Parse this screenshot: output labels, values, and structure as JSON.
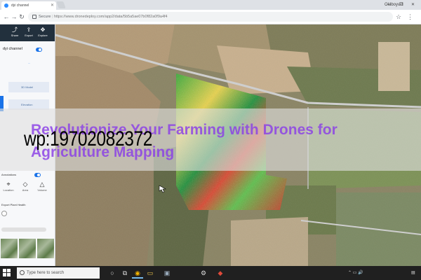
{
  "browser": {
    "tab_title": "dyi channel",
    "window_user": "Oldboyvid",
    "window_controls": "— ❐ ✕",
    "address_prefix": "Secure",
    "url": "https://www.dronedeploy.com/app2/data/5b5a5ae07b0f82a0f9a4f4",
    "nav_back": "←",
    "nav_forward": "→",
    "nav_reload": "↻",
    "star_icon": "☆",
    "menu_icon": "⋮"
  },
  "sidebar": {
    "tools": [
      {
        "icon": "share-icon",
        "glyph": "⤴",
        "label": "Share"
      },
      {
        "icon": "export-icon",
        "glyph": "⇪",
        "label": "Export"
      },
      {
        "icon": "explore-icon",
        "glyph": "✥",
        "label": "Explore"
      }
    ],
    "panel_title": "dyi channel",
    "link_text": "...",
    "view_3d": "3D Model",
    "view_elevation": "Elevation",
    "annotations_label": "Annotations",
    "annotation_tools": [
      {
        "icon": "location-icon",
        "glyph": "⌖",
        "label": "Location"
      },
      {
        "icon": "area-icon",
        "glyph": "◇",
        "label": "Area"
      },
      {
        "icon": "volume-icon",
        "glyph": "△",
        "label": "Volume"
      }
    ],
    "plant_health_label": "Export Plant Health"
  },
  "watermark": {
    "title": "Revolutionize Your Farming with Drones for Agriculture Mapping",
    "code": "wp:19702082372"
  },
  "taskbar": {
    "search_placeholder": "Type here to search",
    "apps": [
      {
        "icon": "cortana-icon",
        "glyph": "○"
      },
      {
        "icon": "task-view-icon",
        "glyph": "⧉"
      },
      {
        "icon": "chrome-icon",
        "glyph": "◉"
      },
      {
        "icon": "file-explorer-icon",
        "glyph": "▭"
      },
      {
        "icon": "store-icon",
        "glyph": "▣"
      },
      {
        "icon": "settings-icon",
        "glyph": "⚙"
      },
      {
        "icon": "app-icon",
        "glyph": "◆"
      }
    ],
    "tray_icons": "⌃  ▭  🔊",
    "notification_icon": "▤"
  }
}
